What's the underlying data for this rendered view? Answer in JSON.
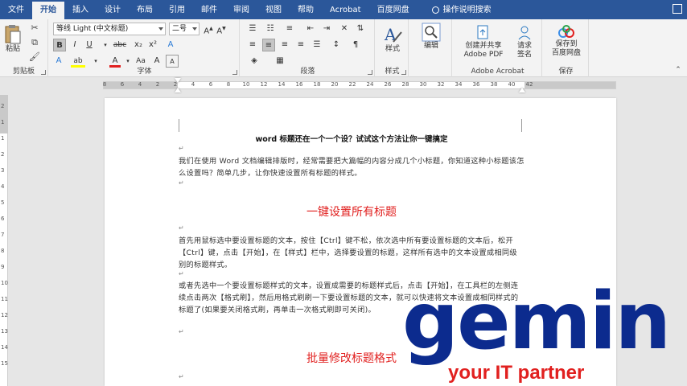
{
  "tabs": [
    "文件",
    "开始",
    "插入",
    "设计",
    "布局",
    "引用",
    "邮件",
    "审阅",
    "视图",
    "帮助",
    "Acrobat",
    "百度网盘"
  ],
  "active_tab": "开始",
  "tell_me": "操作说明搜索",
  "ribbon": {
    "clipboard": {
      "paste_label": "粘贴",
      "group_label": "剪贴板"
    },
    "font": {
      "font_name": "等线 Light (中文标题)",
      "font_size": "二号",
      "bold": "B",
      "italic": "I",
      "underline": "U",
      "strike": "abc",
      "subscript": "x₂",
      "superscript": "x²",
      "clear": "A",
      "highlight": "ab",
      "font_color": "A",
      "change_case": "Aa",
      "enlarge": "A",
      "group_label": "字体"
    },
    "paragraph": {
      "group_label": "段落"
    },
    "styles": {
      "styles_label": "样式",
      "group_label": "样式"
    },
    "editing": {
      "label": "编辑"
    },
    "acrobat": {
      "create_share_label": "创建并共享\nAdobe PDF",
      "request_sign_label": "请求\n签名",
      "group_label": "Adobe Acrobat"
    },
    "save": {
      "label": "保存到\n百度网盘",
      "group_label": "保存"
    }
  },
  "ruler_ticks": [
    "8",
    "6",
    "4",
    "2",
    "2",
    "4",
    "6",
    "8",
    "10",
    "12",
    "14",
    "16",
    "18",
    "20",
    "22",
    "24",
    "26",
    "28",
    "30",
    "32",
    "34",
    "36",
    "38",
    "40",
    "42"
  ],
  "vruler_ticks": [
    "2",
    "1",
    "1",
    "2",
    "3",
    "4",
    "5",
    "6",
    "7",
    "8",
    "9",
    "10",
    "11",
    "12",
    "13",
    "14",
    "15"
  ],
  "document": {
    "title": "word 标题还在一个一个设？试试这个方法让你一键搞定",
    "intro": "我们在使用 Word 文档编辑排版时，经常需要把大篇幅的内容分成几个小标题，你知道这种小标题该怎么设置吗？简单几步，让你快速设置所有标题的样式。",
    "heading1": "一键设置所有标题",
    "para1": "首先用鼠标选中要设置标题的文本，按住【Ctrl】键不松，依次选中所有要设置标题的文本后，松开【Ctrl】键，点击【开始】，在【样式】栏中，选择要设置的标题，这样所有选中的文本设置成相同级别的标题样式。",
    "para2": "或者先选中一个要设置标题样式的文本，设置成需要的标题样式后，点击【开始】，在工具栏的左侧连续点击两次【格式刷】，然后用格式刷刷一下要设置标题的文本，就可以快速将文本设置成相同样式的标题了(如果要关闭格式刷，再单击一次格式刷即可关闭)。",
    "heading2": "批量修改标题格式",
    "para_mark": "↵"
  },
  "watermark": {
    "word": "gemin",
    "tagline": "your IT partner"
  },
  "colors": {
    "ribbon_blue": "#2b579a",
    "heading_red": "#e1201f",
    "logo_blue": "#0c2b8e"
  }
}
